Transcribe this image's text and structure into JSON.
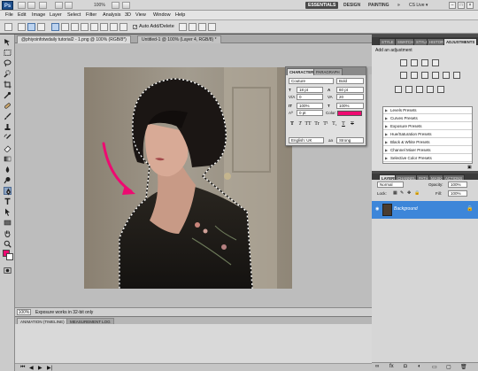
{
  "app_bar": {
    "logo": "Ps",
    "zoom": "100%",
    "workspaces": [
      "ESSENTIALS",
      "DESIGN",
      "PAINTING"
    ],
    "more": "»",
    "cs_live": "CS Live ▾"
  },
  "menu": [
    "File",
    "Edit",
    "Image",
    "Layer",
    "Select",
    "Filter",
    "Analysis",
    "3D",
    "View",
    "Window",
    "Help"
  ],
  "options": {
    "auto_add_delete": "Auto Add/Delete"
  },
  "document": {
    "tabs": [
      "@phiyoinfotwdaily tutorial2 - 1.png @ 100% (RGB/8*)",
      "Untitled-1 @ 100% (Layer 4, RGB/8) *"
    ],
    "zoom_field": "100%",
    "status": "Exposure works in 32-bit only"
  },
  "bottom_panel": {
    "tabs": [
      "ANIMATION (TIMELINE)",
      "MEASUREMENT LOG"
    ]
  },
  "adjustments_panel": {
    "tabs": [
      "STYLE",
      "SWATCHES",
      "STYLES",
      "HISTORY",
      "ADJUSTMENTS"
    ],
    "title": "Add an adjustment",
    "presets": [
      "Levels Presets",
      "Curves Presets",
      "Exposure Presets",
      "Hue/Saturation Presets",
      "Black & White Presets",
      "Channel Mixer Presets",
      "Selective Color Presets"
    ]
  },
  "layers_panel": {
    "tabs": [
      "LAYERS",
      "CHANNELS",
      "PATHS",
      "MASKS",
      "ACTIONS"
    ],
    "blend_mode": "Normal",
    "opacity_label": "Opacity:",
    "opacity": "100%",
    "lock_label": "Lock:",
    "fill_label": "Fill:",
    "fill": "100%",
    "layers": [
      {
        "name": "Background",
        "selected": true
      }
    ]
  },
  "character_panel": {
    "tabs": [
      "CHARACTER",
      "PARAGRAPH"
    ],
    "font_family": "Couture",
    "font_style": "Bold",
    "font_size": "18 pt",
    "leading": "60 pt",
    "kerning": "0",
    "tracking": "20",
    "vertical_scale": "100%",
    "horizontal_scale": "100%",
    "baseline_shift": "0 pt",
    "color_label": "Color:",
    "color": "#ee0a71",
    "style_buttons": [
      "T",
      "T",
      "TT",
      "Tr",
      "T¹",
      "T₁",
      "T",
      "T"
    ],
    "language": "English: UK",
    "antialias_label": "aa",
    "antialias": "Strong"
  },
  "colors": {
    "accent": "#ee0a71",
    "selection_blue": "#3d86d9"
  }
}
